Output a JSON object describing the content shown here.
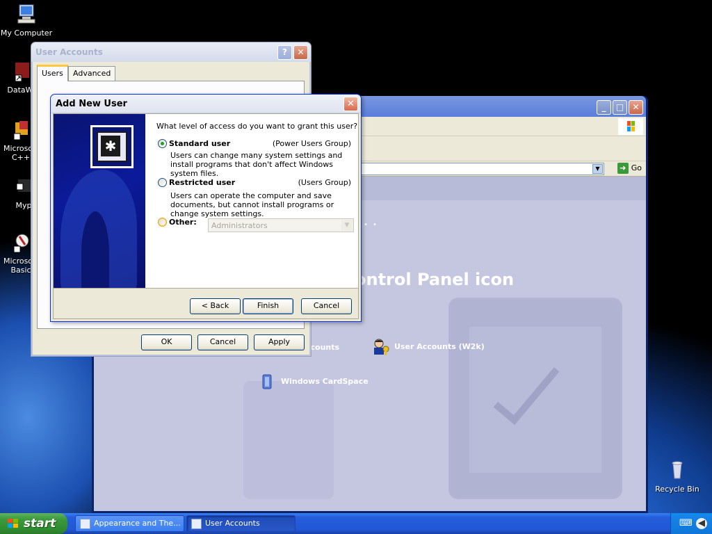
{
  "desktop": {
    "icons": [
      {
        "label": "My Computer",
        "icon": "my-computer-icon"
      },
      {
        "label": "DataWa",
        "icon": "shortcut-icon"
      },
      {
        "label": "Microsoft C++",
        "icon": "visual-cpp-icon"
      },
      {
        "label": "Myp",
        "icon": "shortcut-icon"
      },
      {
        "label": "Microsoft Basic",
        "icon": "visual-basic-icon"
      },
      {
        "label": "Recycle Bin",
        "icon": "recycle-bin-icon"
      }
    ]
  },
  "control_panel": {
    "address_go": "Go",
    "dots": "• • •",
    "pick_heading": "ontrol Panel icon",
    "items": [
      {
        "label": "ccounts",
        "icon": "user-accounts-icon"
      },
      {
        "label": "User Accounts (W2k)",
        "icon": "user-accounts-w2k-icon"
      },
      {
        "label": "Windows CardSpace",
        "icon": "cardspace-icon"
      }
    ]
  },
  "user_accounts": {
    "title": "User Accounts",
    "tabs": [
      "Users",
      "Advanced"
    ],
    "buttons": {
      "ok": "OK",
      "cancel": "Cancel",
      "apply": "Apply"
    }
  },
  "add_new_user": {
    "title": "Add New User",
    "question": "What level of access do you want to grant this user?",
    "options": [
      {
        "label": "Standard user",
        "group": "(Power Users Group)",
        "description": "Users can change many system settings and install programs that don't affect Windows system files.",
        "selected": true
      },
      {
        "label": "Restricted user",
        "group": "(Users Group)",
        "description": "Users can operate the computer and save documents, but cannot install programs or change system settings.",
        "selected": false
      },
      {
        "label": "Other:",
        "selected": false,
        "select_value": "Administrators"
      }
    ],
    "buttons": {
      "back": "< Back",
      "finish": "Finish",
      "cancel": "Cancel"
    }
  },
  "taskbar": {
    "start_label": "start",
    "tasks": [
      {
        "label": "Appearance and The...",
        "active": false
      },
      {
        "label": "User Accounts",
        "active": true
      }
    ]
  }
}
